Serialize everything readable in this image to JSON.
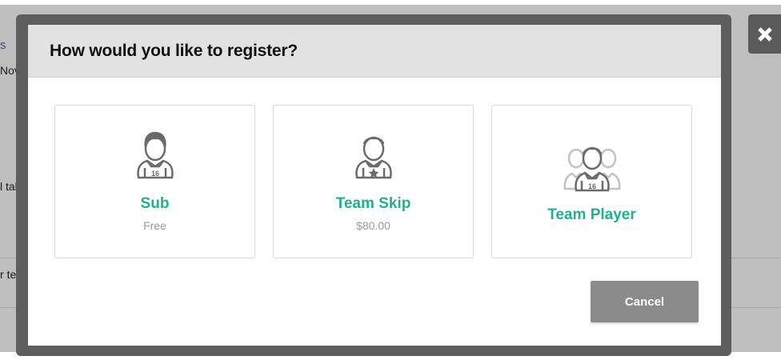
{
  "modal": {
    "title": "How would you like to register?",
    "options": [
      {
        "title": "Sub",
        "price": "Free",
        "icon": "player-number-icon",
        "jersey_number": "16"
      },
      {
        "title": "Team Skip",
        "price": "$80.00",
        "icon": "player-star-icon"
      },
      {
        "title": "Team Player",
        "price": "",
        "icon": "team-players-icon",
        "jersey_number": "16"
      }
    ],
    "cancel_label": "Cancel"
  },
  "background": {
    "fragments": [
      "s",
      "Nov",
      "l tak",
      "r te"
    ]
  },
  "colors": {
    "accent": "#1fb08f",
    "price": "#9a9a9a",
    "cancel_button": "#8b8b8b",
    "header": "#e2e2e2",
    "frame": "#5e5e5e"
  }
}
